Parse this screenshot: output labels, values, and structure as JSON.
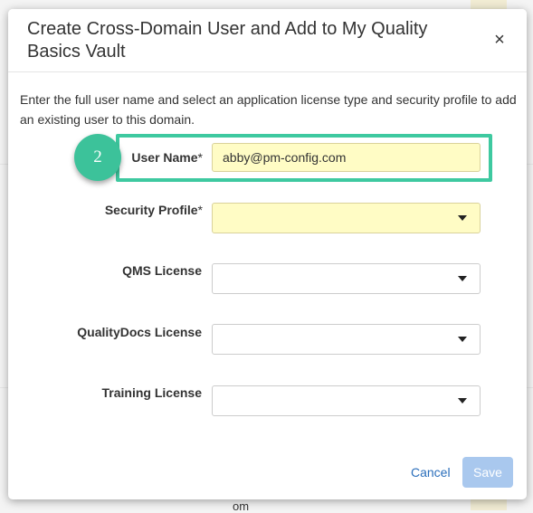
{
  "backdrop": {
    "text": "om"
  },
  "dialog": {
    "title": "Create Cross-Domain User and Add to My Quality Basics Vault",
    "close_symbol": "×",
    "intro": "Enter the full user name and select an application license type and security profile to add an existing user to this domain."
  },
  "form": {
    "user_name": {
      "label": "User Name",
      "required_mark": "*",
      "value": "abby@pm-config.com"
    },
    "security_profile": {
      "label": "Security Profile",
      "required_mark": "*",
      "value": ""
    },
    "qms_license": {
      "label": "QMS License",
      "value": ""
    },
    "qualitydocs_license": {
      "label": "QualityDocs License",
      "value": ""
    },
    "training_license": {
      "label": "Training License",
      "value": ""
    }
  },
  "annotation": {
    "step_number": "2",
    "highlight_color": "#3ec9a0",
    "badge_color": "#3cc29a"
  },
  "footer": {
    "cancel_label": "Cancel",
    "save_label": "Save"
  },
  "icons": {
    "close": "close-icon",
    "dropdown": "caret-down-icon"
  }
}
